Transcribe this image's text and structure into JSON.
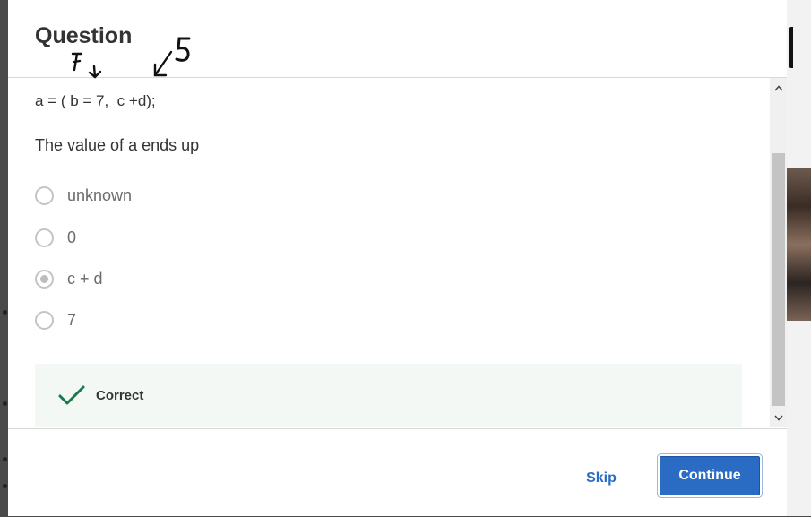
{
  "dialog": {
    "title": "Question",
    "annotation": {
      "left_mark": "F",
      "right_mark": "5"
    }
  },
  "question": {
    "code_line": "a = ( b = 7,  c +d);",
    "prompt": "The value of a ends up",
    "options": [
      {
        "label": "unknown",
        "selected": false
      },
      {
        "label": "0",
        "selected": false
      },
      {
        "label": "c + d",
        "selected": true
      },
      {
        "label": "7",
        "selected": false
      }
    ]
  },
  "feedback": {
    "label": "Correct",
    "icon": "check-icon",
    "color": "#1a7a4c"
  },
  "footer": {
    "skip_label": "Skip",
    "continue_label": "Continue"
  },
  "colors": {
    "accent": "#2a6cc4",
    "feedback_bg": "#f3f8f5"
  }
}
